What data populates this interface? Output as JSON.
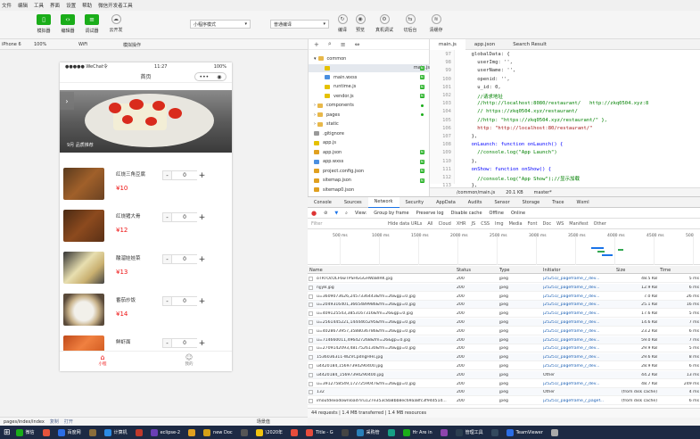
{
  "menu": [
    "文件",
    "编辑",
    "工具",
    "界面",
    "设置",
    "帮助",
    "微信开发者工具"
  ],
  "toolbar": {
    "sim": "模拟器",
    "editor": "编辑器",
    "debugger": "调试器",
    "cloud": "云开发",
    "mode": "小程序模式",
    "compile_mode": "普通编译",
    "compile": "编译",
    "preview": "预览",
    "real_debug": "真机调试",
    "backend": "切后台",
    "clear_cache": "清缓存"
  },
  "devbar": {
    "device": "iPhone 6",
    "zoom": "100%",
    "network": "WiFi",
    "ops": "模拟操作"
  },
  "phone": {
    "carrier": "●●●●● WeChat令",
    "time": "11:27",
    "battery": "100%",
    "title": "首页",
    "caption": "9月 品质推荐",
    "more": "•••",
    "price_prefix": "¥",
    "items": [
      {
        "name": "红烧三角豆腐",
        "price": "10",
        "qty": "0"
      },
      {
        "name": "红烧猪大骨",
        "price": "12",
        "qty": "0"
      },
      {
        "name": "酸溜娃娃菜",
        "price": "13",
        "qty": "0"
      },
      {
        "name": "番茄炒饭",
        "price": "14",
        "qty": "0"
      },
      {
        "name": "鲜虾面",
        "price": "",
        "qty": "0"
      }
    ],
    "tabs": [
      {
        "label": "小程"
      },
      {
        "label": "我的"
      }
    ]
  },
  "footer": {
    "path": "pages/index/index",
    "copy": "复制",
    "open": "打开",
    "scene": "场景值"
  },
  "filetree": [
    {
      "name": "common",
      "type": "folder",
      "open": true,
      "indent": 0
    },
    {
      "name": "main.js",
      "type": "js",
      "indent": 1,
      "badge": "M",
      "selected": true
    },
    {
      "name": "main.wxss",
      "type": "wxss",
      "indent": 1,
      "badge": "M"
    },
    {
      "name": "runtime.js",
      "type": "js",
      "indent": 1,
      "badge": "M"
    },
    {
      "name": "vendor.js",
      "type": "js",
      "indent": 1,
      "badge": "M"
    },
    {
      "name": "components",
      "type": "folder",
      "indent": 0,
      "dot": true
    },
    {
      "name": "pages",
      "type": "folder",
      "indent": 0,
      "dot": true
    },
    {
      "name": "static",
      "type": "folder",
      "indent": 0
    },
    {
      "name": ".gitignore",
      "type": "file",
      "indent": 0
    },
    {
      "name": "app.js",
      "type": "js",
      "indent": 0
    },
    {
      "name": "app.json",
      "type": "json",
      "indent": 0,
      "badge": "M"
    },
    {
      "name": "app.wxss",
      "type": "wxss",
      "indent": 0,
      "badge": "M"
    },
    {
      "name": "project.config.json",
      "type": "json",
      "indent": 0,
      "badge": "M"
    },
    {
      "name": "sitemap.json",
      "type": "json",
      "indent": 0,
      "badge": "M"
    },
    {
      "name": "sitemap0.json",
      "type": "json",
      "indent": 0
    }
  ],
  "editor": {
    "tabs": [
      "main.js",
      "app.json",
      "Search Result"
    ],
    "lines": [
      {
        "n": "97",
        "t": "  globalData: {"
      },
      {
        "n": "98",
        "t": "    userImg: '',"
      },
      {
        "n": "99",
        "t": "    userName: '',"
      },
      {
        "n": "100",
        "t": "    openid: '',"
      },
      {
        "n": "101",
        "t": "    u_id: 0,"
      },
      {
        "n": "102",
        "t": "    //请求地址"
      },
      {
        "n": "103",
        "t": "    //http://localhost:8080/restaurant/   http://zkq0504.xyz:8"
      },
      {
        "n": "104",
        "t": "    // https://zkq0504.xyz/restaurant/"
      },
      {
        "n": "105",
        "t": "    //http: \"https://zkq0504.xyz/restaurant/\" },"
      },
      {
        "n": "106",
        "t": "    http: \"http://localhost:80/restaurant/\""
      },
      {
        "n": "107",
        "t": "  },"
      },
      {
        "n": "108",
        "t": "  onLaunch: function onLaunch() {"
      },
      {
        "n": "109",
        "t": "    //console.log(\"App Launch\")"
      },
      {
        "n": "110",
        "t": "  },"
      },
      {
        "n": "111",
        "t": "  onShow: function onShow() {"
      },
      {
        "n": "112",
        "t": "    //console.log(\"App Show\");//显示加载"
      },
      {
        "n": "113",
        "t": "  },"
      }
    ],
    "status_path": "/common/main.js",
    "status_size": "20.1 KB",
    "status_branch": "master*"
  },
  "devtools": {
    "tabs": [
      "Console",
      "Sources",
      "Network",
      "Security",
      "AppData",
      "Audits",
      "Sensor",
      "Storage",
      "Trace",
      "Wxml"
    ],
    "toolbar": {
      "view": "View:",
      "group": "Group by frame",
      "preserve": "Preserve log",
      "cache": "Disable cache",
      "offline": "Offline",
      "online": "Online"
    },
    "filter": {
      "placeholder": "Filter",
      "hide": "Hide data URLs",
      "types": [
        "All",
        "Cloud",
        "XHR",
        "JS",
        "CSS",
        "Img",
        "Media",
        "Font",
        "Doc",
        "WS",
        "Manifest",
        "Other"
      ]
    },
    "ticks": [
      "500 ms",
      "1000 ms",
      "1500 ms",
      "2000 ms",
      "2500 ms",
      "3000 ms",
      "3500 ms",
      "4000 ms",
      "4500 ms",
      "500"
    ],
    "columns": [
      "Name",
      "Status",
      "Type",
      "Initiator",
      "Size",
      "Time"
    ],
    "rows": [
      {
        "name": "oTRTOcOLF6wTPSHGGGHWa8IRK.jpg",
        "status": "200",
        "type": "jpeg",
        "init": "j25251/_pageframe_/_dev...",
        "size": "48.5 KB",
        "time": "5 ms"
      },
      {
        "name": "njjy8.jpg",
        "status": "200",
        "type": "jpeg",
        "init": "j25251/_pageframe_/_dev...",
        "size": "12.9 KB",
        "time": "6 ms"
      },
      {
        "name": "u=3609073626,2457336443&fm=26&gp=0.jpg",
        "status": "200",
        "type": "jpeg",
        "init": "j25251/_pageframe_/_dev...",
        "size": "7.0 KB",
        "time": "26 ms"
      },
      {
        "name": "u=2049316401,3665489986&fm=26&gp=0.jpg",
        "status": "200",
        "type": "jpeg",
        "init": "j25251/_pageframe_/_dev...",
        "size": "25.1 KB",
        "time": "16 ms"
      },
      {
        "name": "u=409125543,3853167316&fm=26&gp=0.jpg",
        "status": "200",
        "type": "jpeg",
        "init": "j25251/_pageframe_/_dev...",
        "size": "17.6 KB",
        "time": "5 ms"
      },
      {
        "name": "u=2561445221,1444465295&fm=26&gp=0.jpg",
        "status": "200",
        "type": "jpeg",
        "init": "j25251/_pageframe_/_dev...",
        "size": "14.6 KB",
        "time": "7 ms"
      },
      {
        "name": "u=4028673957,3588036786&fm=26&gp=0.jpg",
        "status": "200",
        "type": "jpeg",
        "init": "j25251/_pageframe_/_dev...",
        "size": "23.2 KB",
        "time": "6 ms"
      },
      {
        "name": "u=714660011,496427268&fm=26&gp=0.jpg",
        "status": "200",
        "type": "jpeg",
        "init": "j25251/_pageframe_/_dev...",
        "size": "59.0 KB",
        "time": "7 ms"
      },
      {
        "name": "u=2709142093,4817526130&fm=26&gp=0.jpg",
        "status": "200",
        "type": "jpeg",
        "init": "j25251/_pageframe_/_dev...",
        "size": "29.9 KB",
        "time": "5 ms"
      },
      {
        "name": "1536036311-WZVCpdngHHs.jpg",
        "status": "200",
        "type": "jpeg",
        "init": "j25251/_pageframe_/_dev...",
        "size": "29.6 KB",
        "time": "8 ms"
      },
      {
        "name": "u4420184,15697394290400.jpg",
        "status": "200",
        "type": "jpeg",
        "init": "j25251/_pageframe_/_dev...",
        "size": "28.9 KB",
        "time": "6 ms"
      },
      {
        "name": "u4420184_15697394290400.jpg",
        "status": "200",
        "type": "jpeg",
        "init": "Other",
        "size": "44.2 KB",
        "time": "13 ms"
      },
      {
        "name": "u=3912758549,1727259047&fm=26&gp=0.jpg",
        "status": "200",
        "type": "jpeg",
        "init": "j25251/_pageframe_/_dev...",
        "size": "48.7 KB",
        "time": "249 ms"
      },
      {
        "name": "132",
        "status": "200",
        "type": "jpeg",
        "init": "Other",
        "size": "(from disk cache)",
        "time": "4 ms"
      },
      {
        "name": "imoutdexodownload?iru127e353c8a8bb8ec69aa8fc3f94d51d...",
        "status": "200",
        "type": "jpeg",
        "init": "j25251/_pageframe_/_pagef...",
        "size": "(from disk cache)",
        "time": "6 ms"
      }
    ],
    "summary": "44 requests | 1.4 MB transferred | 1.4 MB resources"
  },
  "taskbar": [
    {
      "label": "微信",
      "color": "#1aad19"
    },
    {
      "label": "",
      "color": "#e5533c"
    },
    {
      "label": "百度网",
      "color": "#2b6de5"
    },
    {
      "label": "",
      "color": "#8a6d3b"
    },
    {
      "label": "计算机",
      "color": "#2b8be5"
    },
    {
      "label": "",
      "color": "#c0392b"
    },
    {
      "label": "eclipse-2",
      "color": "#6a3fb5"
    },
    {
      "label": "",
      "color": "#e0a020"
    },
    {
      "label": "new Doc",
      "color": "#d4a017"
    },
    {
      "label": "",
      "color": "#555"
    },
    {
      "label": "\\2020年",
      "color": "#f1c40f"
    },
    {
      "label": "",
      "color": "#e74c3c"
    },
    {
      "label": "Title - G",
      "color": "#e74c3c"
    },
    {
      "label": "",
      "color": "#444"
    },
    {
      "label": "采购管",
      "color": "#2980b9"
    },
    {
      "label": "",
      "color": "#16a085"
    },
    {
      "label": "Hr Are in",
      "color": "#1aad19"
    },
    {
      "label": "",
      "color": "#8e44ad"
    },
    {
      "label": "管理工具",
      "color": "#2c3e50"
    },
    {
      "label": "",
      "color": "#34495e"
    },
    {
      "label": "TeamViewer",
      "color": "#2b6de5"
    },
    {
      "label": "",
      "color": "#aaa"
    }
  ]
}
